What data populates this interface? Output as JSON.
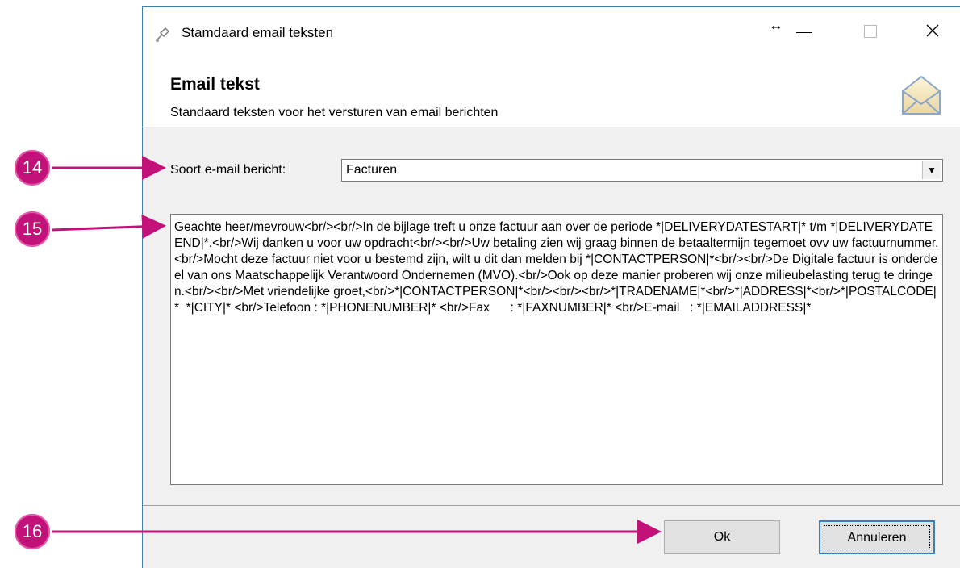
{
  "window": {
    "title": "Stamdaard email teksten",
    "resize_glyph": "↔"
  },
  "header": {
    "title": "Email tekst",
    "subtitle": "Standaard teksten voor het versturen van email berichten",
    "icon": "envelope-icon"
  },
  "form": {
    "type_label": "Soort e-mail bericht:",
    "type_value": "Facturen",
    "dropdown_arrow": "▼",
    "body_text": "Geachte heer/mevrouw<br/><br/>In de bijlage treft u onze factuur aan over de periode *|DELIVERYDATESTART|* t/m *|DELIVERYDATEEND|*.<br/>Wij danken u voor uw opdracht<br/><br/>Uw betaling zien wij graag binnen de betaaltermijn tegemoet ovv uw factuurnummer.<br/>Mocht deze factuur niet voor u bestemd zijn, wilt u dit dan melden bij *|CONTACTPERSON|*<br/><br/>De Digitale factuur is onderdeel van ons Maatschappelijk Verantwoord Ondernemen (MVO).<br/>Ook op deze manier proberen wij onze milieubelasting terug te dringen.<br/><br/>Met vriendelijke groet,<br/>*|CONTACTPERSON|*<br/><br/><br/>*|TRADENAME|*<br/>*|ADDRESS|*<br/>*|POSTALCODE|*  *|CITY|* <br/>Telefoon : *|PHONENUMBER|* <br/>Fax      : *|FAXNUMBER|* <br/>E-mail   : *|EMAILADDRESS|*"
  },
  "buttons": {
    "ok_label": "Ok",
    "cancel_label": "Annuleren"
  },
  "callouts": [
    {
      "number": "14"
    },
    {
      "number": "15"
    },
    {
      "number": "16"
    }
  ],
  "colors": {
    "callout": "#c2127a",
    "window_border": "#3c7fb1"
  }
}
